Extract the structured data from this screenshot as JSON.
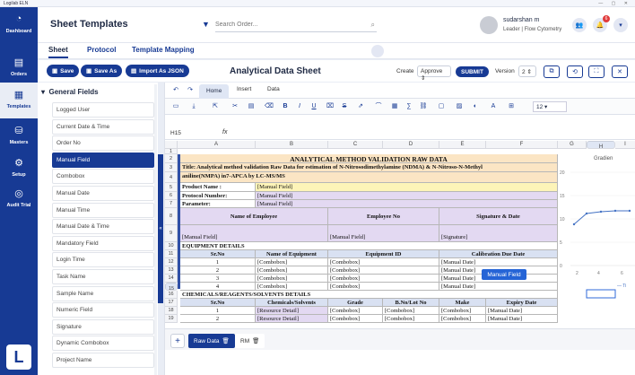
{
  "window": {
    "title": "Logilab ELN",
    "controls": "— ▢ ✕"
  },
  "leftnav": [
    {
      "icon": "dashboard-icon",
      "glyph": "◔",
      "label": "Dashboard"
    },
    {
      "icon": "orders-icon",
      "glyph": "▤",
      "label": "Orders"
    },
    {
      "icon": "templates-icon",
      "glyph": "▦",
      "label": "Templates"
    },
    {
      "icon": "masters-icon",
      "glyph": "⛁",
      "label": "Masters"
    },
    {
      "icon": "setup-icon",
      "glyph": "⚙",
      "label": "Setup"
    },
    {
      "icon": "audit-trail-icon",
      "glyph": "◎",
      "label": "Audit Trial"
    }
  ],
  "header": {
    "title": "Sheet Templates",
    "search_placeholder": "Search Order...",
    "user_name": "sudarshan m",
    "user_role": "Leader | Flow Cytometry",
    "notification_count": "6"
  },
  "tabs": [
    "Sheet",
    "Protocol",
    "Template Mapping"
  ],
  "actions": {
    "save": "Save",
    "save_as": "Save As",
    "import_json": "Import As JSON",
    "sheet_title": "Analytical Data Sheet",
    "create_label": "Create",
    "create_value": "Approve",
    "submit": "SUBMIT",
    "version_label": "Version",
    "version_value": "2"
  },
  "fields_panel": {
    "heading": "General Fields",
    "items": [
      "Logged User",
      "Current Date & Time",
      "Order No",
      "Manual Field",
      "Combobox",
      "Manual Date",
      "Manual Time",
      "Manual Date & Time",
      "Mandatory Field",
      "Login Time",
      "Task Name",
      "Sample Name",
      "Numeric Field",
      "Signature",
      "Dynamic Combobox",
      "Project Name"
    ],
    "active_index": 3
  },
  "spreadsheet": {
    "tabs": [
      "Home",
      "Insert",
      "Data"
    ],
    "font_size": "12",
    "cell_ref": "H15",
    "fx": "fx",
    "columns": [
      "A",
      "B",
      "C",
      "D",
      "E",
      "F",
      "G",
      "H",
      "I"
    ],
    "rows": [
      "1",
      "2",
      "3",
      "4",
      "5",
      "6",
      "7",
      "8",
      "9",
      "10",
      "11",
      "12",
      "13",
      "14",
      "15",
      "16",
      "17",
      "18",
      "19"
    ],
    "r2": "ANALYTICAL METHOD VALIDATION RAW DATA",
    "r3": "Title: Analytical method validation Raw Data for estimation of N-Nitrosodimethylamine (NDMA) & N-Nitroso-N-Methyl",
    "r4": "aniline(NMPA) in7-APCA by LC-MS/MS",
    "r5_label": "Product Name :",
    "r5_value": "[Manual Field]",
    "r6_label": "Protocol Number:",
    "r6_value": "[Manual Field]",
    "r7_label": "Parameter:",
    "r7_value": "[Manual Field]",
    "r8_h1": "Name of Employee",
    "r8_h2": "Employee No",
    "r8_h3": "Signature & Date",
    "r9_v1": "[Manual Field]",
    "r9_v2": "[Manual Field]",
    "r9_v3": "[Signature]",
    "r10": "EQUIPMENT DETAILS",
    "r11": [
      "Sr.No",
      "Name of Equipment",
      "Equipment ID",
      "Calibration Due Date"
    ],
    "equip_rows": [
      [
        "1",
        "[Combobox]",
        "[Combobox]",
        "[Manual Date]"
      ],
      [
        "2",
        "[Combobox]",
        "[Combobox]",
        "[Manual Date]"
      ],
      [
        "3",
        "[Combobox]",
        "[Combobox]",
        "[Manual Date]"
      ],
      [
        "4",
        "[Combobox]",
        "[Combobox]",
        "[Manual Date]"
      ]
    ],
    "r16": "CHEMICALS/REAGENTS/SOLVENTS DETAILS",
    "r17": [
      "Sr.No",
      "Chemicals/Solvents",
      "Grade",
      "B.No/Lot No",
      "Make",
      "Expiry Date"
    ],
    "r18": [
      "1",
      "[Resource Detail]",
      "[Combobox]",
      "[Combobox]",
      "[Combobox]",
      "[Manual Date]"
    ],
    "r19": [
      "2",
      "[Resource Detail]",
      "[Combobox]",
      "[Combobox]",
      "[Combobox]",
      "[Manual Date]"
    ],
    "tooltip": "Manual Field",
    "chart_title": "Gradien",
    "chart_ticks_y": [
      "20",
      "15",
      "10",
      "5",
      "0"
    ],
    "chart_ticks_x": [
      "2",
      "4",
      "6"
    ],
    "chart_legend": "— Ti",
    "sheet_tabs": [
      "Raw Data",
      "RM"
    ]
  }
}
